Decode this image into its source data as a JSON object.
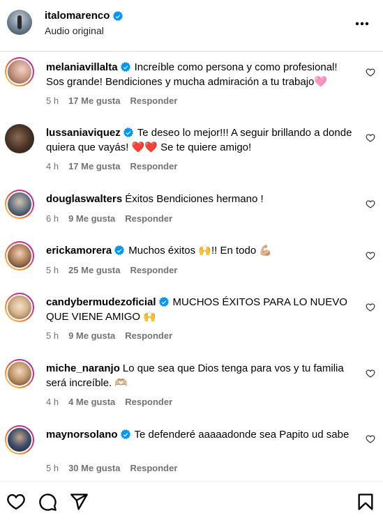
{
  "header": {
    "username": "italomarenco",
    "subtitle": "Audio original",
    "verified": true,
    "more_icon": "more-horizontal-icon"
  },
  "comments": [
    {
      "username": "melaniavillalta",
      "verified": true,
      "text": "Increíble como persona y como profesional! Sos grande! Bendiciones y mucha admiración a tu trabajo🩷",
      "time": "5 h",
      "likes": "17 Me gusta",
      "reply": "Responder"
    },
    {
      "username": "lussaniaviquez",
      "verified": true,
      "text": "Te deseo lo mejor!!! A seguir brillando a donde quiera que vayás! ❤️❤️ Se te quiere amigo!",
      "time": "4 h",
      "likes": "17 Me gusta",
      "reply": "Responder"
    },
    {
      "username": "douglaswalters",
      "verified": false,
      "text": "Éxitos Bendiciones hermano !",
      "time": "6 h",
      "likes": "9 Me gusta",
      "reply": "Responder"
    },
    {
      "username": "erickamorera",
      "verified": true,
      "text": "Muchos éxitos 🙌!! En todo 💪🏼",
      "time": "5 h",
      "likes": "25 Me gusta",
      "reply": "Responder"
    },
    {
      "username": "candybermudezoficial",
      "verified": true,
      "text": "MUCHOS ÉXITOS PARA LO NUEVO QUE VIENE AMIGO 🙌",
      "time": "5 h",
      "likes": "9 Me gusta",
      "reply": "Responder"
    },
    {
      "username": "miche_naranjo",
      "verified": false,
      "text": "Lo que sea que Dios tenga para vos y tu familia será increíble. 🫶🏼",
      "time": "4 h",
      "likes": "4 Me gusta",
      "reply": "Responder"
    },
    {
      "username": "maynorsolano",
      "verified": true,
      "text": "Te defenderé aaaaadonde sea Papito ud sabe",
      "time": "5 h",
      "likes": "30 Me gusta",
      "reply": "Responder"
    }
  ],
  "footer": {
    "icons": [
      "heart-icon",
      "comment-icon",
      "share-icon",
      "bookmark-icon"
    ]
  },
  "colors": {
    "verified": "#0095f6",
    "meta": "#737373",
    "divider": "#dbdbdb"
  }
}
